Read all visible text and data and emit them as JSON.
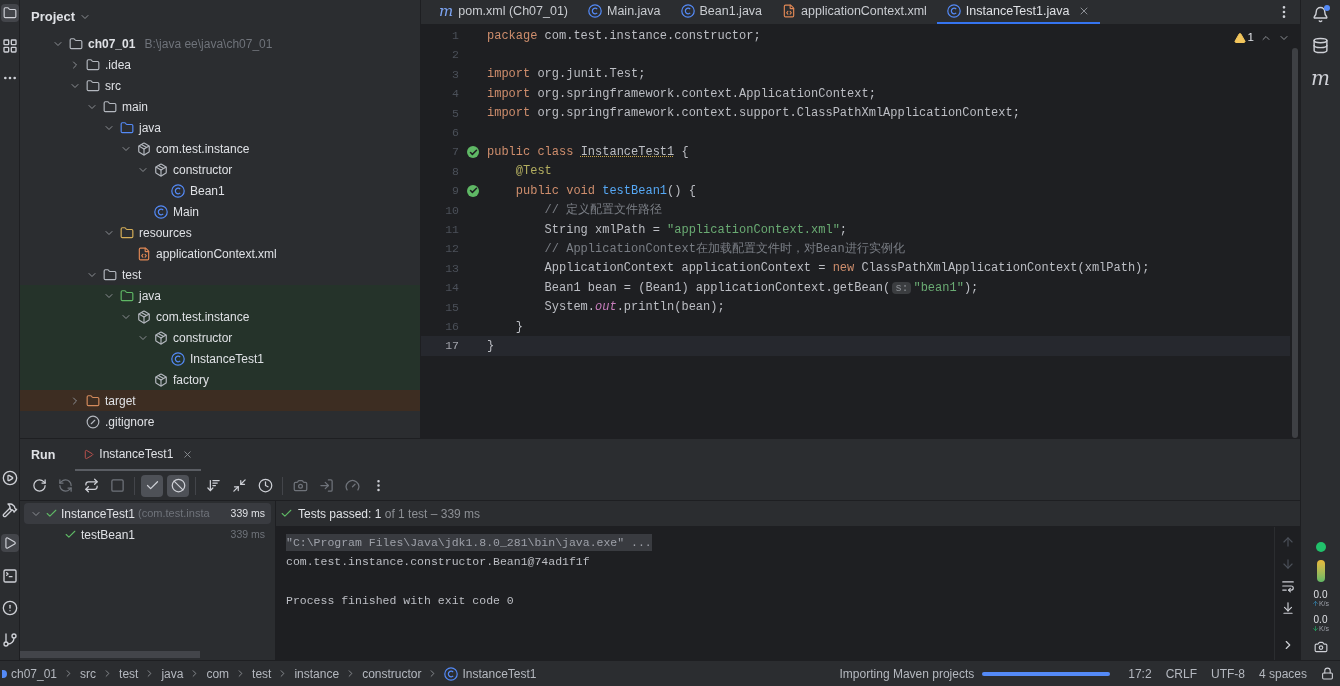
{
  "project_panel": {
    "title": "Project",
    "tree": [
      {
        "label": "ch07_01",
        "path": "B:\\java ee\\java\\ch07_01",
        "kind": "module",
        "expanded": true,
        "children": [
          {
            "label": ".idea",
            "kind": "folder",
            "expanded": false
          },
          {
            "label": "src",
            "kind": "folder",
            "expanded": true,
            "children": [
              {
                "label": "main",
                "kind": "folder",
                "expanded": true,
                "children": [
                  {
                    "label": "java",
                    "kind": "source_root",
                    "expanded": true,
                    "children": [
                      {
                        "label": "com.test.instance",
                        "kind": "package",
                        "expanded": true,
                        "children": [
                          {
                            "label": "constructor",
                            "kind": "package",
                            "expanded": true,
                            "children": [
                              {
                                "label": "Bean1",
                                "kind": "class"
                              }
                            ]
                          },
                          {
                            "label": "Main",
                            "kind": "class"
                          }
                        ]
                      }
                    ]
                  },
                  {
                    "label": "resources",
                    "kind": "resources_root",
                    "expanded": true,
                    "children": [
                      {
                        "label": "applicationContext.xml",
                        "kind": "xml"
                      }
                    ]
                  }
                ]
              },
              {
                "label": "test",
                "kind": "folder",
                "expanded": true,
                "children": [
                  {
                    "label": "java",
                    "kind": "test_root",
                    "expanded": true,
                    "children": [
                      {
                        "label": "com.test.instance",
                        "kind": "package",
                        "expanded": true,
                        "children": [
                          {
                            "label": "constructor",
                            "kind": "package",
                            "expanded": true,
                            "children": [
                              {
                                "label": "InstanceTest1",
                                "kind": "class"
                              }
                            ]
                          },
                          {
                            "label": "factory",
                            "kind": "package"
                          }
                        ]
                      }
                    ]
                  }
                ]
              }
            ]
          },
          {
            "label": "target",
            "kind": "excluded_folder",
            "expanded": false
          },
          {
            "label": ".gitignore",
            "kind": "ignore_file"
          }
        ]
      }
    ]
  },
  "editor_tabs": [
    {
      "label": "pom.xml (Ch07_01)",
      "kind": "maven",
      "icon_glyph": "m",
      "selected": false
    },
    {
      "label": "Main.java",
      "kind": "class",
      "selected": false
    },
    {
      "label": "Bean1.java",
      "kind": "class",
      "selected": false
    },
    {
      "label": "applicationContext.xml",
      "kind": "xml",
      "selected": false
    },
    {
      "label": "InstanceTest1.java",
      "kind": "class",
      "selected": true
    }
  ],
  "editor": {
    "warnings": "1",
    "lines": [
      {
        "number": "1",
        "run_marker": false,
        "current": false,
        "tokens": [
          {
            "kind": "keyword",
            "text": "package "
          },
          {
            "kind": "plain",
            "text": "com.test.instance.constructor;"
          }
        ]
      },
      {
        "number": "2",
        "run_marker": false,
        "current": false
      },
      {
        "number": "3",
        "run_marker": false,
        "current": false,
        "tokens": [
          {
            "kind": "keyword",
            "text": "import "
          },
          {
            "kind": "plain",
            "text": "org.junit.Test;"
          }
        ]
      },
      {
        "number": "4",
        "run_marker": false,
        "current": false,
        "tokens": [
          {
            "kind": "keyword",
            "text": "import "
          },
          {
            "kind": "plain",
            "text": "org.springframework.context.ApplicationContext;"
          }
        ]
      },
      {
        "number": "5",
        "run_marker": false,
        "current": false,
        "tokens": [
          {
            "kind": "keyword",
            "text": "import "
          },
          {
            "kind": "plain",
            "text": "org.springframework.context.support.ClassPathXmlApplicationContext;"
          }
        ]
      },
      {
        "number": "6",
        "run_marker": false,
        "current": false
      },
      {
        "number": "7",
        "run_marker": true,
        "current": false,
        "tokens": [
          {
            "kind": "keyword",
            "text": "public class "
          },
          {
            "kind": "warning",
            "text": "InstanceTest1"
          },
          {
            "kind": "plain",
            "text": " {"
          }
        ]
      },
      {
        "number": "8",
        "run_marker": false,
        "current": false,
        "tokens": [
          {
            "kind": "annotation",
            "text": "    @Test"
          }
        ]
      },
      {
        "number": "9",
        "run_marker": true,
        "current": false,
        "tokens": [
          {
            "kind": "keyword",
            "text": "    public void "
          },
          {
            "kind": "method",
            "text": "testBean1"
          },
          {
            "kind": "plain",
            "text": "() {"
          }
        ]
      },
      {
        "number": "10",
        "run_marker": false,
        "current": false,
        "tokens": [
          {
            "kind": "comment",
            "text": "        // 定义配置文件路径"
          }
        ]
      },
      {
        "number": "11",
        "run_marker": false,
        "current": false,
        "tokens": [
          {
            "kind": "plain",
            "text": "        String xmlPath = "
          },
          {
            "kind": "string",
            "text": "\"applicationContext.xml\""
          },
          {
            "kind": "plain",
            "text": ";"
          }
        ]
      },
      {
        "number": "12",
        "run_marker": false,
        "current": false,
        "tokens": [
          {
            "kind": "comment",
            "text": "        // ApplicationContext在加载配置文件时，对Bean进行实例化"
          }
        ]
      },
      {
        "number": "13",
        "run_marker": false,
        "current": false,
        "tokens": [
          {
            "kind": "plain",
            "text": "        ApplicationContext applicationContext = "
          },
          {
            "kind": "keyword",
            "text": "new "
          },
          {
            "kind": "plain",
            "text": "ClassPathXmlApplicationContext(xmlPath);"
          }
        ]
      },
      {
        "number": "14",
        "run_marker": false,
        "current": false,
        "tokens": [
          {
            "kind": "plain",
            "text": "        Bean1 bean = (Bean1) applicationContext.getBean("
          },
          {
            "kind": "hint",
            "text": "s:"
          },
          {
            "kind": "string",
            "text": "\"bean1\""
          },
          {
            "kind": "plain",
            "text": ");"
          }
        ]
      },
      {
        "number": "15",
        "run_marker": false,
        "current": false,
        "tokens": [
          {
            "kind": "plain",
            "text": "        System."
          },
          {
            "kind": "static",
            "text": "out"
          },
          {
            "kind": "plain",
            "text": ".println(bean);"
          }
        ]
      },
      {
        "number": "16",
        "run_marker": false,
        "current": false,
        "tokens": [
          {
            "kind": "plain",
            "text": "    }"
          }
        ]
      },
      {
        "number": "17",
        "run_marker": false,
        "current": true,
        "tokens": [
          {
            "kind": "plain",
            "text": "}"
          }
        ]
      }
    ]
  },
  "run_panel": {
    "title": "Run",
    "tabs": [
      {
        "label": "InstanceTest1",
        "selected": true
      }
    ],
    "toolbar": [
      {
        "kind": "rerun",
        "on": false
      },
      {
        "kind": "rerun_failed",
        "on": false
      },
      {
        "kind": "toggle_auto",
        "on": false
      },
      {
        "kind": "stop",
        "on": false
      },
      {
        "kind": "show_passed",
        "on": true
      },
      {
        "kind": "show_ignored",
        "on": true
      },
      {
        "kind": "sort",
        "on": false
      },
      {
        "kind": "collapse",
        "on": false
      },
      {
        "kind": "history",
        "on": false
      },
      {
        "kind": "screenshot",
        "on": false
      },
      {
        "kind": "import",
        "on": false
      },
      {
        "kind": "coverage",
        "on": false
      },
      {
        "kind": "more",
        "on": false
      }
    ],
    "tests": [
      {
        "name": "InstanceTest1",
        "detail": "(com.test.insta",
        "time": "339 ms",
        "selected": true,
        "expanded": true,
        "children": [
          {
            "name": "testBean1",
            "time": "339 ms",
            "selected": false
          }
        ]
      }
    ],
    "summary": "**Tests passed: 1** of 1 test – 339 ms",
    "console": [
      {
        "kind": "command",
        "text": "\"C:\\Program Files\\Java\\jdk1.8.0_281\\bin\\java.exe\" ..."
      },
      {
        "kind": "output",
        "text": "com.test.instance.constructor.Bean1@74ad1f1f"
      },
      {
        "kind": "blank"
      },
      {
        "kind": "output",
        "text": "Process finished with exit code 0"
      }
    ]
  },
  "status_bar": {
    "breadcrumbs": [
      {
        "label": "ch07_01",
        "kind": "module"
      },
      {
        "label": "src",
        "kind": "folder"
      },
      {
        "label": "test",
        "kind": "folder"
      },
      {
        "label": "java",
        "kind": "folder"
      },
      {
        "label": "com",
        "kind": "folder"
      },
      {
        "label": "test",
        "kind": "folder"
      },
      {
        "label": "instance",
        "kind": "folder"
      },
      {
        "label": "constructor",
        "kind": "folder"
      },
      {
        "label": "InstanceTest1",
        "kind": "class"
      }
    ],
    "task": "Importing Maven projects",
    "task_progress": {
      "level": 1
    },
    "items": [
      "17:2",
      "CRLF",
      "UTF-8",
      "4 spaces"
    ]
  },
  "right_stripe": {
    "maven_glyph": "m",
    "upload": "0.0",
    "upload_unit": "K/s",
    "download": "0.0",
    "download_unit": "K/s"
  }
}
